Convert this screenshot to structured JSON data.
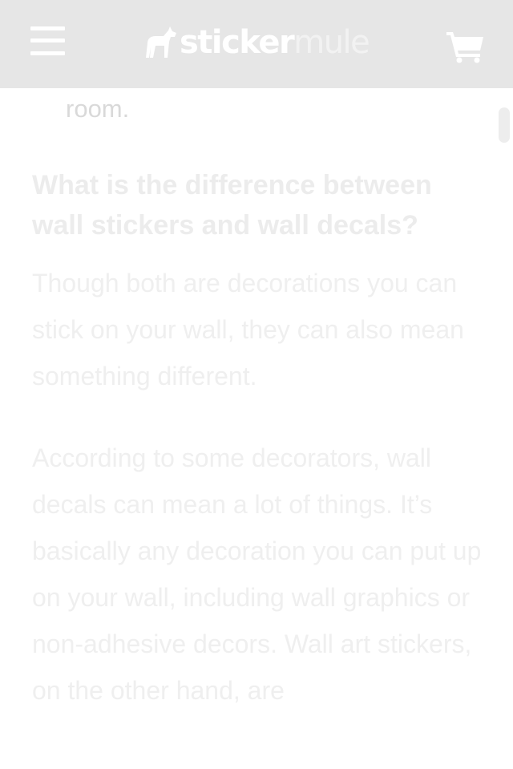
{
  "header": {
    "logo_brand_bold": "sticker",
    "logo_brand_light": "mule",
    "menu_icon": "hamburger-menu-icon",
    "cart_icon": "shopping-cart-icon",
    "background_color": "#e6e6e6",
    "icon_color": "#ffffff"
  },
  "article": {
    "top_fragment": "room.",
    "faq": {
      "question": "What is the difference between wall stickers and wall decals?",
      "answer_paragraphs": [
        "Though both are decorations you can stick on your wall, they can also mean something different.",
        "According to some decorators, wall decals can mean a lot of things. It’s basically any decoration you can put up on your wall, including wall graphics or non-adhesive decors. Wall art stickers, on the other hand, are"
      ]
    }
  }
}
